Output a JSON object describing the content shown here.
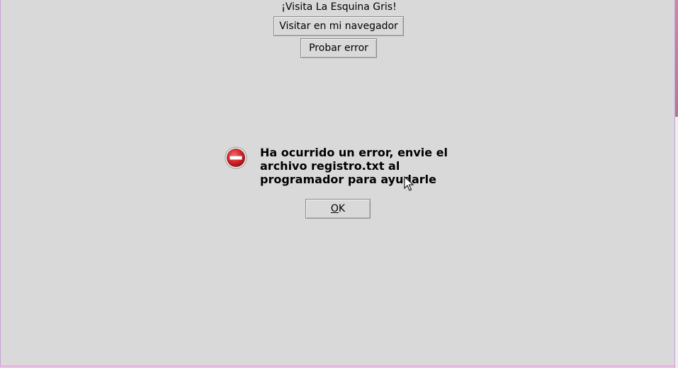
{
  "main": {
    "headline": "¡Visita La Esquina Gris!",
    "visit_button_label": "Visitar en mi navegador",
    "test_error_button_label": "Probar error"
  },
  "dialog": {
    "icon": "error-icon",
    "message": "Ha ocurrido un error, envie el archivo registro.txt al programador para ayudarle",
    "ok_mnemonic": "O",
    "ok_rest": "K"
  },
  "colors": {
    "background": "#d9d9d9",
    "error_red": "#d8262a",
    "window_border": "#c8a2d8"
  }
}
